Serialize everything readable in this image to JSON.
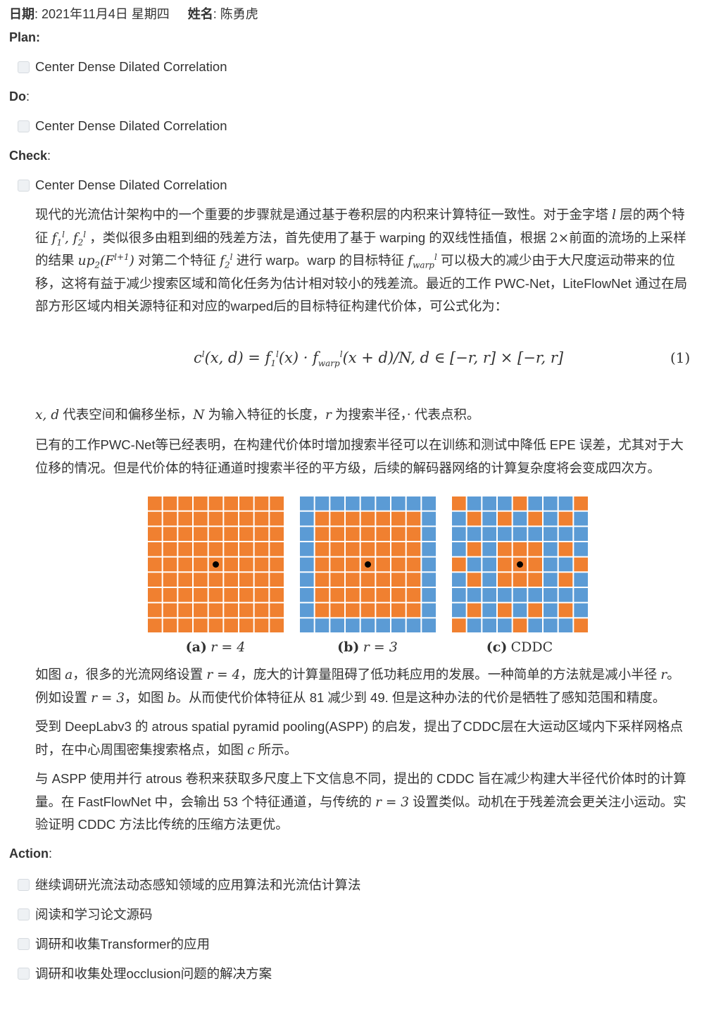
{
  "header": {
    "date_label": "日期",
    "date_value": ": 2021年11月4日 星期四",
    "name_label": "姓名",
    "name_value": ": 陈勇虎"
  },
  "plan": {
    "label": "Plan",
    "colon": ":",
    "task": "Center Dense Dilated Correlation"
  },
  "do": {
    "label": "Do",
    "colon": ":",
    "task": "Center Dense Dilated Correlation"
  },
  "check": {
    "label": "Check",
    "colon": ":",
    "task": "Center Dense Dilated Correlation"
  },
  "para1": {
    "l1a": "现代的光流估计架构中的一个重要的步骤就是通过基于卷积层的内积来计算特征一致性。对于金字塔",
    "l1b": "层的两个特",
    "l2a": "征",
    "l2b": "，类似很多由粗到细的残差方法，首先使用了基于 warping 的双线性插值，根据",
    "l2c": "前面的流场的上采样",
    "l3a": "的结果",
    "l3b": "对第二个特征",
    "l3c": "进行 warp。warp 的目标特征",
    "l3d": "可以极大的减少由于大尺度运动带来的位",
    "l4": "移，这将有益于减少搜索区域和简化任务为估计相对较小的残差流。最近的工作 PWC-Net，LiteFlowNet 通过在局",
    "l5": "部方形区域内相关源特征和对应的warped后的目标特征构建代价体，可公式化为："
  },
  "equation": {
    "number": "(1)"
  },
  "para2": {
    "text": "代表空间和偏移坐标，",
    "t2": "为输入特征的长度，",
    "t3": "为搜索半径，",
    "t4": "代表点积。"
  },
  "para3": {
    "l1": "已有的工作PWC-Net等已经表明，在构建代价体时增加搜索半径可以在训练和测试中降低 EPE 误差，尤其对于大",
    "l2": "位移的情况。但是代价体的特征通道时搜索半径的平方级，后续的解码器网络的计算复杂度将会变成四次方。"
  },
  "figure": {
    "colors": {
      "orange": "#f08030",
      "blue": "#5b9bd5",
      "dot": "#000000"
    },
    "grid_size": 9,
    "captions": [
      {
        "tag": "(a)",
        "text": "r = 4"
      },
      {
        "tag": "(b)",
        "text": "r = 3"
      },
      {
        "tag": "(c)",
        "text": "CDDC"
      }
    ]
  },
  "para4": {
    "l1a": "如图",
    "l1b": "，很多的光流网络设置",
    "l1c": "，庞大的计算量阻碍了低功耗应用的发展。一种简单的方法就是减小半径",
    "l2a": "例如设置",
    "l2b": "，如图",
    "l2c": "。从而使代价体特征从 81 减少到 49. 但是这种办法的代价是牺牲了感知范围和精度。"
  },
  "para5": {
    "l1": "受到 DeepLabv3 的 atrous spatial pyramid pooling(ASPP) 的启发，提出了CDDC层在大运动区域内下采样网格点",
    "l2a": "时，在中心周围密集搜索格点，如图",
    "l2b": "所示。"
  },
  "para6": {
    "l1": "与 ASPP 使用并行 atrous 卷积来获取多尺度上下文信息不同，提出的 CDDC 旨在减少构建大半径代价体时的计算",
    "l2a": "量。在 FastFlowNet 中，会输出 53 个特征通道，与传统的",
    "l2b": "设置类似。动机在于残差流会更关注小运动。实",
    "l3": "验证明 CDDC 方法比传统的压缩方法更优。"
  },
  "action": {
    "label": "Action",
    "colon": ":",
    "tasks": [
      "继续调研光流法动态感知领域的应用算法和光流估计算法",
      "阅读和学习论文源码",
      "调研和收集Transformer的应用",
      "调研和收集处理occlusion问题的解决方案"
    ]
  }
}
